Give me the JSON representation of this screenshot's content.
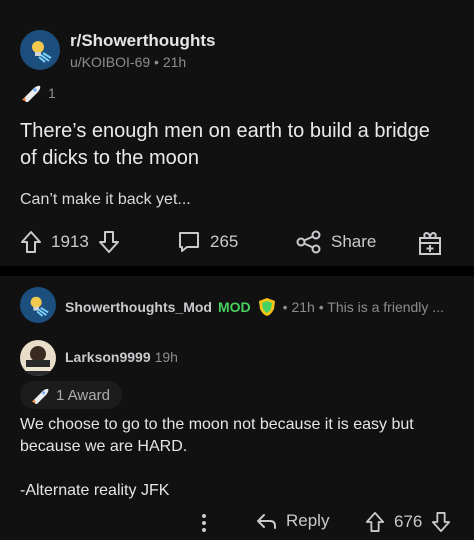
{
  "post": {
    "subreddit": "r/Showerthoughts",
    "author": "u/KOIBOI-69",
    "age": "21h",
    "award_count": "1",
    "title": "There’s enough men on earth to build a bridge of dicks to the moon",
    "body": "Can’t make it back yet...",
    "upvotes": "1913",
    "comments": "265",
    "share_label": "Share"
  },
  "mod_comment": {
    "author": "Showerthoughts_Mod",
    "mod_tag": "MOD",
    "age": "21h",
    "preview": "This is a friendly ..."
  },
  "comment": {
    "author": "Larkson9999",
    "age": "19h",
    "awards": "1 Award",
    "body_line1": "We choose to go to the moon not because it is easy but because we are HARD.",
    "body_line2": "-Alternate reality JFK",
    "reply_label": "Reply",
    "score": "676"
  },
  "colors": {
    "background": "#111111",
    "separator": "#000000",
    "mod_green": "#46d160",
    "subreddit_blue": "#1c4f7d"
  },
  "icons": [
    "lightbulb-icon",
    "rocket-award-icon",
    "upvote-icon",
    "downvote-icon",
    "comment-icon",
    "share-icon",
    "gift-award-icon",
    "mod-shield-icon",
    "more-icon",
    "reply-icon"
  ]
}
